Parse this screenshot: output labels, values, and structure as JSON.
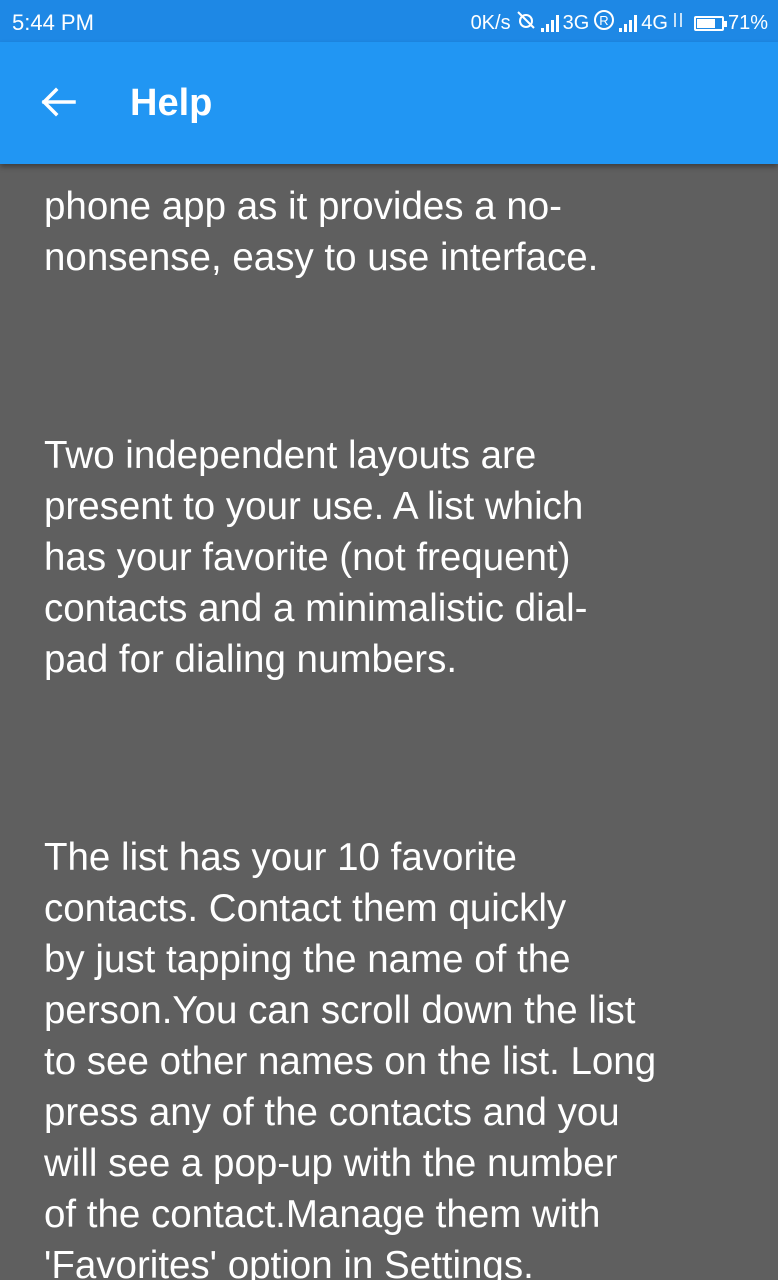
{
  "status_bar": {
    "time": "5:44 PM",
    "network_speed": "0K/s",
    "network_1": "3G",
    "roaming": "R",
    "network_2": "4G",
    "battery": "71%",
    "battery_level": 0.71
  },
  "app_bar": {
    "back_icon": "arrow-left-icon",
    "title": "Help",
    "color": "#2196f3"
  },
  "help": {
    "paragraphs": [
      "phone app as it provides a no-\nnonsense, easy to use interface.",
      "Two independent layouts are\npresent to your use. A list which\nhas your favorite (not frequent)\ncontacts and a minimalistic dial-\npad for dialing numbers.",
      "The list has your 10 favorite\ncontacts. Contact them quickly\nby just tapping the name of the\nperson.You can scroll down the list\nto see other names on the list. Long\npress any of the contacts and you\nwill see a pop-up with the number\nof the contact.Manage them with\n'Favorites' option in Settings."
    ]
  },
  "colors": {
    "status_bar": "#1e88e5",
    "background": "#5f5f5f",
    "text": "#ffffff"
  }
}
